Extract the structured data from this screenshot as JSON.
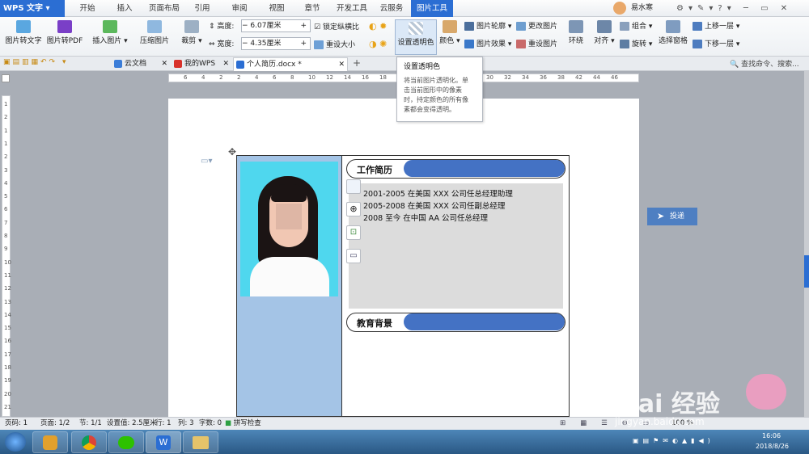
{
  "app": {
    "logo": "WPS 文字",
    "user": "易水寒"
  },
  "menu_tabs": [
    "开始",
    "插入",
    "页面布局",
    "引用",
    "审阅",
    "视图",
    "章节",
    "开发工具",
    "云服务",
    "图片工具"
  ],
  "ribbon": {
    "pic_to_text": "图片转文字",
    "pic_to_pdf": "图片转PDF",
    "insert_pic": "插入图片",
    "compress_pic": "压缩图片",
    "crop": "裁剪",
    "height_label": "高度:",
    "height_value": "6.07厘米",
    "width_label": "宽度:",
    "width_value": "4.35厘米",
    "lock_ratio": "锁定纵横比",
    "reset_size": "重设大小",
    "set_transparent": "设置透明色",
    "color": "颜色",
    "pic_outline": "图片轮廓",
    "pic_effect": "图片效果",
    "change_pic": "更改图片",
    "reset_pic": "重设图片",
    "wrap": "环绕",
    "align": "对齐",
    "group": "组合",
    "rotate": "旋转",
    "select_pane": "选择窗格",
    "bring_forward": "上移一层",
    "send_backward": "下移一层"
  },
  "doc_tabs": [
    {
      "label": "云文档"
    },
    {
      "label": "我的WPS"
    },
    {
      "label": "个人简历.docx *"
    }
  ],
  "search_text": "查找命令、搜索...",
  "tooltip": {
    "title": "设置透明色",
    "desc": [
      "将当前图片透明化。单",
      "击当前图形中的像素",
      "时，持定颜色的所有像",
      "素都会变得透明。"
    ]
  },
  "ruler": {
    "h_ticks": [
      "6",
      "4",
      "2",
      "2",
      "4",
      "6",
      "8",
      "10",
      "12",
      "14",
      "16",
      "18",
      "20",
      "22",
      "24",
      "26",
      "28",
      "30",
      "32",
      "34",
      "36",
      "38",
      "42",
      "44",
      "46"
    ],
    "v_ticks": [
      "1",
      "2",
      "1",
      "1",
      "2",
      "3",
      "4",
      "5",
      "6",
      "7",
      "8",
      "9",
      "10",
      "11",
      "12",
      "13",
      "14",
      "15",
      "16",
      "17",
      "18",
      "19",
      "20",
      "21"
    ]
  },
  "resume": {
    "section1_title": "工作简历",
    "work": [
      "2001-2005  在美国 XXX 公司任总经理助理",
      "2005-2008  在美国 XXX 公司任副总经理",
      "2008 至今  在中国 AA 公司任总经理"
    ],
    "section2_title": "教育背景"
  },
  "send_button": "投递",
  "status": {
    "page_no": "页码: 1",
    "pages": "页面: 1/2",
    "section": "节: 1/1",
    "setting": "设置值: 2.5厘米",
    "row": "行: 1",
    "col": "列: 3",
    "words": "字数: 0",
    "spell": "拼写检查",
    "zoom": "100 %"
  },
  "clock": {
    "time": "16:06",
    "date": "2018/8/26"
  },
  "watermark": {
    "text": "Bai 经验",
    "url": "jingyan.baidu.com"
  },
  "colors": {
    "accent": "#2b6ed3",
    "photo_bg": "#a4c4e6",
    "pill_bar": "#4472c4",
    "work_bg": "#dcdcdc"
  }
}
